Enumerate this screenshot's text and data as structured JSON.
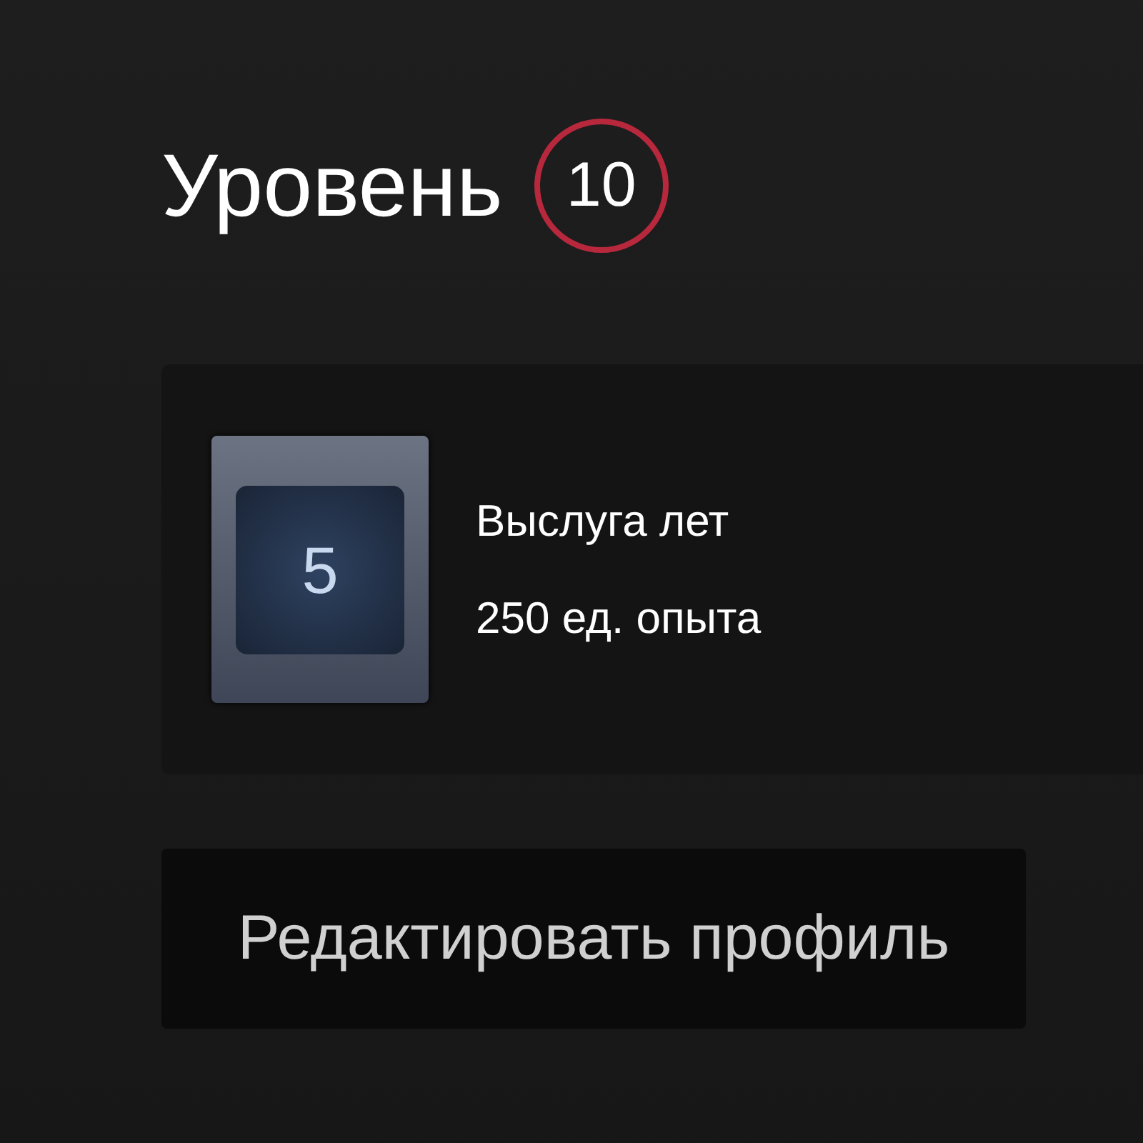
{
  "level": {
    "label": "Уровень",
    "number": "10"
  },
  "badge": {
    "number": "5",
    "name": "Выслуга лет",
    "xp": "250 ед. опыта"
  },
  "edit_button": {
    "label": "Редактировать профиль"
  }
}
